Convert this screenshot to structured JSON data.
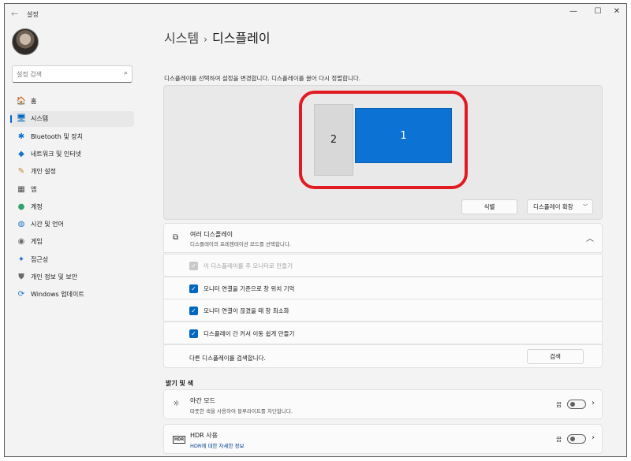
{
  "window": {
    "title": "설정",
    "controls": {
      "minimize": "—",
      "maximize": "☐",
      "close": "✕"
    }
  },
  "sidebar": {
    "search_placeholder": "설정 검색",
    "items": [
      {
        "label": "홈",
        "icon": "home-icon",
        "glyph": "🏠",
        "color": "#c0703a",
        "selected": false
      },
      {
        "label": "시스템",
        "icon": "monitor-icon",
        "glyph": "🖥",
        "color": "#0067c0",
        "selected": true
      },
      {
        "label": "Bluetooth 및 장치",
        "icon": "bluetooth-icon",
        "glyph": "✱",
        "color": "#0a6fd0",
        "selected": false
      },
      {
        "label": "네트워크 및 인터넷",
        "icon": "wifi-icon",
        "glyph": "◆",
        "color": "#1b73c7",
        "selected": false
      },
      {
        "label": "개인 설정",
        "icon": "brush-icon",
        "glyph": "✎",
        "color": "#c9822b",
        "selected": false
      },
      {
        "label": "앱",
        "icon": "apps-icon",
        "glyph": "▦",
        "color": "#4a4a4a",
        "selected": false
      },
      {
        "label": "계정",
        "icon": "account-icon",
        "glyph": "●",
        "color": "#2fa36b",
        "selected": false
      },
      {
        "label": "시간 및 언어",
        "icon": "globe-clock-icon",
        "glyph": "◍",
        "color": "#1b73c7",
        "selected": false
      },
      {
        "label": "게임",
        "icon": "gamepad-icon",
        "glyph": "◉",
        "color": "#6b6b6b",
        "selected": false
      },
      {
        "label": "접근성",
        "icon": "accessibility-icon",
        "glyph": "✦",
        "color": "#1b73c7",
        "selected": false
      },
      {
        "label": "개인 정보 및 보안",
        "icon": "shield-icon",
        "glyph": "⛊",
        "color": "#6b6b6b",
        "selected": false
      },
      {
        "label": "Windows 업데이트",
        "icon": "update-icon",
        "glyph": "⟳",
        "color": "#1b73c7",
        "selected": false
      }
    ]
  },
  "main": {
    "breadcrumb": {
      "parent": "시스템",
      "separator": "›",
      "current": "디스플레이"
    },
    "instruction": "디스플레이를 선택하여 설정을 변경합니다. 디스플레이를 끌어 다시 정렬합니다.",
    "arrangement": {
      "monitor_1_label": "1",
      "monitor_2_label": "2",
      "identify_label": "식별",
      "extend_label": "디스플레이 확장"
    },
    "multi_display": {
      "title": "여러 디스플레이",
      "description": "디스플레이의 프레젠테이션 모드를 선택합니다.",
      "options": [
        {
          "label": "이 디스플레이를 주 모니터로 만들기",
          "checked": true,
          "disabled": true
        },
        {
          "label": "모니터 연결을 기준으로 창 위치 기억",
          "checked": true,
          "disabled": false
        },
        {
          "label": "모니터 연결이 끊겼을 때 창 최소화",
          "checked": true,
          "disabled": false
        },
        {
          "label": "디스플레이 간 커서 이동 쉽게 만들기",
          "checked": true,
          "disabled": false
        }
      ],
      "detect_label": "다른 디스플레이를 검색합니다.",
      "detect_button": "검색"
    },
    "brightness_section": {
      "heading": "밝기 및 색",
      "night_light": {
        "title": "야간 모드",
        "description": "따뜻한 색을 사용하여 블루라이트를 차단합니다.",
        "state": "끔",
        "on": false
      },
      "hdr": {
        "badge": "HDR",
        "title": "HDR 사용",
        "link": "HDR에 대한 자세한 정보",
        "state": "끔",
        "on": false
      }
    }
  },
  "colors": {
    "accent": "#0067c0",
    "monitor_selected": "#0c72d3",
    "highlight_annotation": "#e21b23"
  }
}
